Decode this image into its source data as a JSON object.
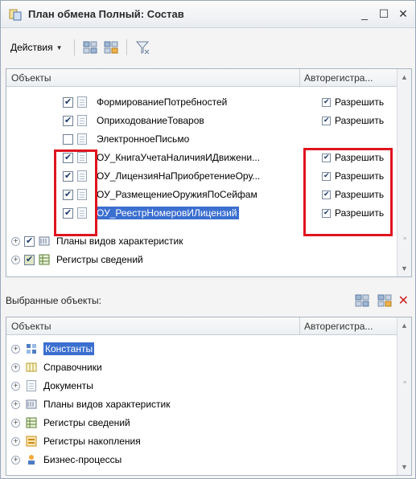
{
  "window": {
    "title": "План обмена Полный: Состав",
    "minimize": "_",
    "maximize": "☐",
    "close": "✕"
  },
  "toolbar": {
    "actions_label": "Действия"
  },
  "top_table": {
    "columns": [
      "Объекты",
      "Авторегистра..."
    ],
    "rows": [
      {
        "name": "ФормированиеПотребностей",
        "checked": true,
        "permission": "Разрешить",
        "perm_checked": true
      },
      {
        "name": "ОприходованиеТоваров",
        "checked": true,
        "permission": "Разрешить",
        "perm_checked": true
      },
      {
        "name": "ЭлектронноеПисьмо",
        "checked": false,
        "permission": "",
        "perm_checked": false
      },
      {
        "name": "ОУ_КнигаУчетаНаличияИДвижени...",
        "checked": true,
        "permission": "Разрешить",
        "perm_checked": true
      },
      {
        "name": "ОУ_ЛицензияНаПриобретениеОру...",
        "checked": true,
        "permission": "Разрешить",
        "perm_checked": true
      },
      {
        "name": "ОУ_РазмещениеОружияПоСейфам",
        "checked": true,
        "permission": "Разрешить",
        "perm_checked": true
      },
      {
        "name": "ОУ_РеестрНомеровИЛицензий",
        "checked": true,
        "permission": "Разрешить",
        "perm_checked": true,
        "selected": true
      }
    ],
    "groups": [
      {
        "name": "Планы видов характеристик",
        "checked": true
      },
      {
        "name": "Регистры сведений",
        "checked": true,
        "partial": true
      }
    ]
  },
  "selected_objects": {
    "label": "Выбранные объекты:",
    "columns": [
      "Объекты",
      "Авторегистра..."
    ],
    "items": [
      {
        "name": "Константы",
        "icon": "constants-icon",
        "selected": true
      },
      {
        "name": "Справочники",
        "icon": "catalogs-icon"
      },
      {
        "name": "Документы",
        "icon": "documents-icon"
      },
      {
        "name": "Планы видов характеристик",
        "icon": "characteristics-icon"
      },
      {
        "name": "Регистры сведений",
        "icon": "info-registers-icon"
      },
      {
        "name": "Регистры накопления",
        "icon": "accumulation-registers-icon"
      },
      {
        "name": "Бизнес-процессы",
        "icon": "business-processes-icon"
      }
    ]
  },
  "colors": {
    "highlight_red": "#e0141e",
    "selection_blue": "#3b6fd0"
  }
}
